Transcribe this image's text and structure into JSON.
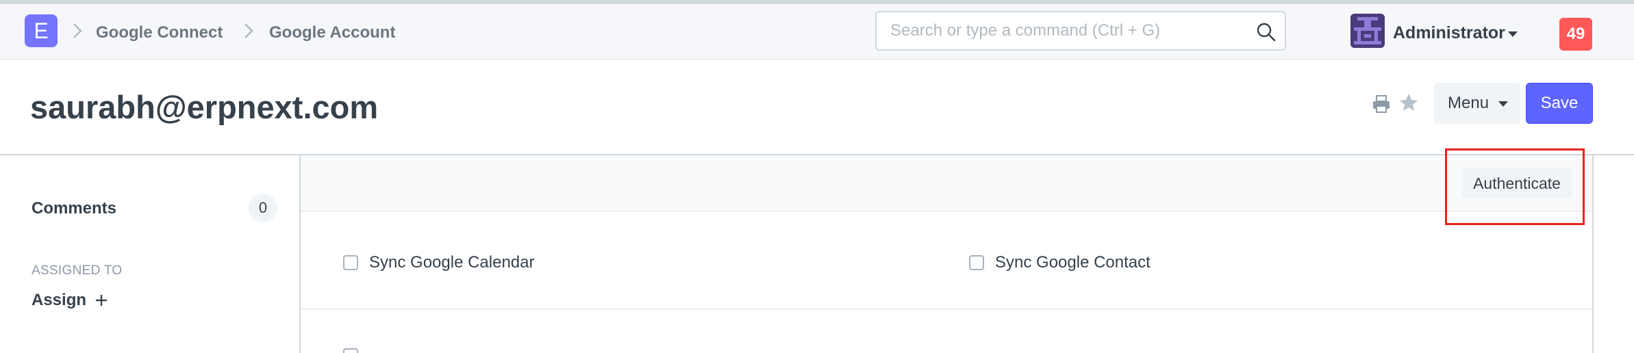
{
  "app": {
    "logo_letter": "E",
    "brand_color": "#7574ff"
  },
  "breadcrumbs": [
    {
      "label": "Google Connect"
    },
    {
      "label": "Google Account"
    }
  ],
  "search": {
    "value": "",
    "placeholder": "Search or type a command (Ctrl + G)"
  },
  "user": {
    "name": "Administrator",
    "notification_count": "49"
  },
  "page": {
    "title": "saurabh@erpnext.com"
  },
  "toolbar": {
    "menu_label": "Menu",
    "save_label": "Save",
    "print_icon": "printer-icon",
    "star_icon": "star-icon"
  },
  "sidebar": {
    "comments_label": "Comments",
    "comments_count": "0",
    "assigned_to_label": "ASSIGNED TO",
    "assign_label": "Assign"
  },
  "form": {
    "authenticate_label": "Authenticate",
    "fields": [
      {
        "label": "Sync Google Calendar",
        "checked": false
      },
      {
        "label": "Sync Google Contact",
        "checked": false
      }
    ]
  },
  "colors": {
    "accent": "#5e64ff",
    "badge": "#ff5858",
    "highlight": "#e8231b"
  }
}
